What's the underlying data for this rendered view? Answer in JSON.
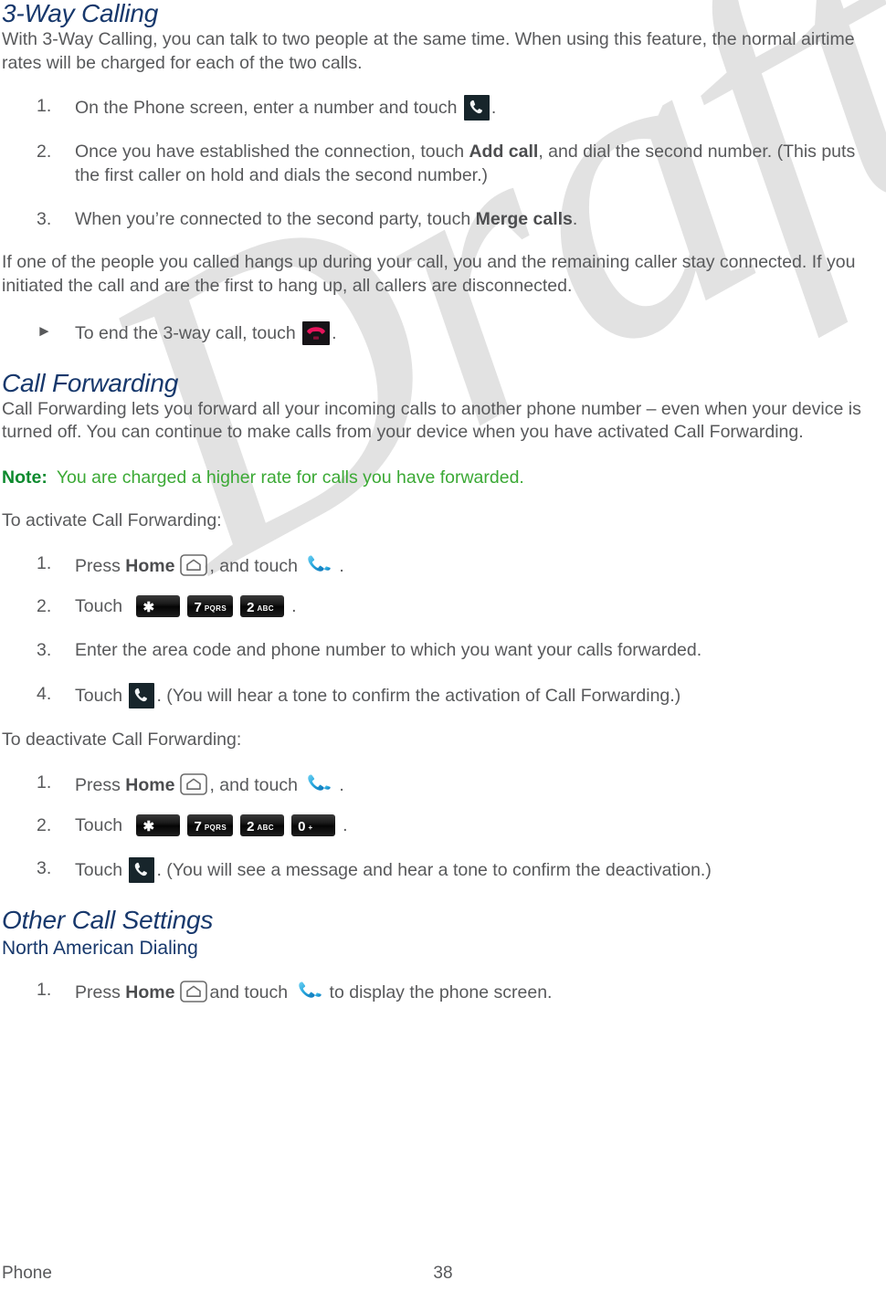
{
  "watermark": {
    "text": "Draft"
  },
  "sections": {
    "three_way": {
      "heading": "3-Way Calling",
      "intro": "With 3-Way Calling, you can talk to two people at the same time. When using this feature, the normal airtime rates will be charged for each of the two calls.",
      "steps": [
        {
          "num": "1.",
          "before": "On the Phone screen, enter a number and touch",
          "icon": "phone-dark-icon",
          "after": "."
        },
        {
          "num": "2.",
          "before": "Once you have established the connection, touch",
          "bold": "Add call",
          "after": ", and dial the second number. (This puts the first caller on hold and dials the second number.)"
        },
        {
          "num": "3.",
          "before": "When you’re connected to the second party, touch",
          "bold": "Merge calls",
          "after": "."
        }
      ],
      "closing": "If one of the people you called hangs up during your call, you and the remaining caller stay connected. If you initiated the call and are the first to hang up, all callers are disconnected.",
      "end_bullet": {
        "arrow": "►",
        "before": "To end the 3-way call, touch",
        "icon": "end-call-icon",
        "after": "."
      }
    },
    "call_forwarding": {
      "heading": "Call Forwarding",
      "intro": "Call Forwarding lets you forward all your incoming calls to another phone number – even when your device is turned off. You can continue to make calls from your device when you have activated Call Forwarding.",
      "note": {
        "label": "Note:",
        "text": "You are charged a higher rate for calls you have forwarded."
      },
      "activate_lead": "To activate Call Forwarding:",
      "activate_steps": [
        {
          "num": "1.",
          "before": "Press",
          "bold": "Home",
          "icon1": "home-key-icon",
          "mid": ", and touch",
          "icon2": "phone-blue-icon",
          "after": "."
        },
        {
          "num": "2.",
          "before": "Touch",
          "keys": [
            {
              "digit": "✱",
              "letters": ""
            },
            {
              "digit": "7",
              "letters": "PQRS"
            },
            {
              "digit": "2",
              "letters": "ABC"
            }
          ],
          "after": "."
        },
        {
          "num": "3.",
          "before": "Enter the area code and phone number to which you want your calls forwarded."
        },
        {
          "num": "4.",
          "before": "Touch",
          "icon": "phone-dark-icon",
          "after": ". (You will hear a tone to confirm the activation of Call Forwarding.)"
        }
      ],
      "deactivate_lead": "To deactivate Call Forwarding:",
      "deactivate_steps": [
        {
          "num": "1.",
          "before": "Press",
          "bold": "Home",
          "icon1": "home-key-icon",
          "mid": ", and touch",
          "icon2": "phone-blue-icon",
          "after": "."
        },
        {
          "num": "2.",
          "before": "Touch",
          "keys": [
            {
              "digit": "✱",
              "letters": ""
            },
            {
              "digit": "7",
              "letters": "PQRS"
            },
            {
              "digit": "2",
              "letters": "ABC"
            },
            {
              "digit": "0",
              "letters": "+"
            }
          ],
          "after": "."
        },
        {
          "num": "3.",
          "before": "Touch",
          "icon": "phone-dark-icon",
          "after": ". (You will see a message and hear a tone to confirm the deactivation.)"
        }
      ]
    },
    "other_call_settings": {
      "heading": "Other Call Settings",
      "subheading": "North American Dialing",
      "steps": [
        {
          "num": "1.",
          "before": "Press",
          "bold": "Home",
          "icon1": "home-key-icon",
          "mid": "and touch",
          "icon2": "phone-blue-icon",
          "after": "to display the phone screen."
        }
      ]
    }
  },
  "footer": {
    "left": "Phone",
    "page_number": "38"
  },
  "colors": {
    "heading": "#17386c",
    "body_text": "#58595b",
    "note_green": "#3ba935",
    "watermark": "#e2e2e2",
    "key_background": "#0a0a0a"
  }
}
